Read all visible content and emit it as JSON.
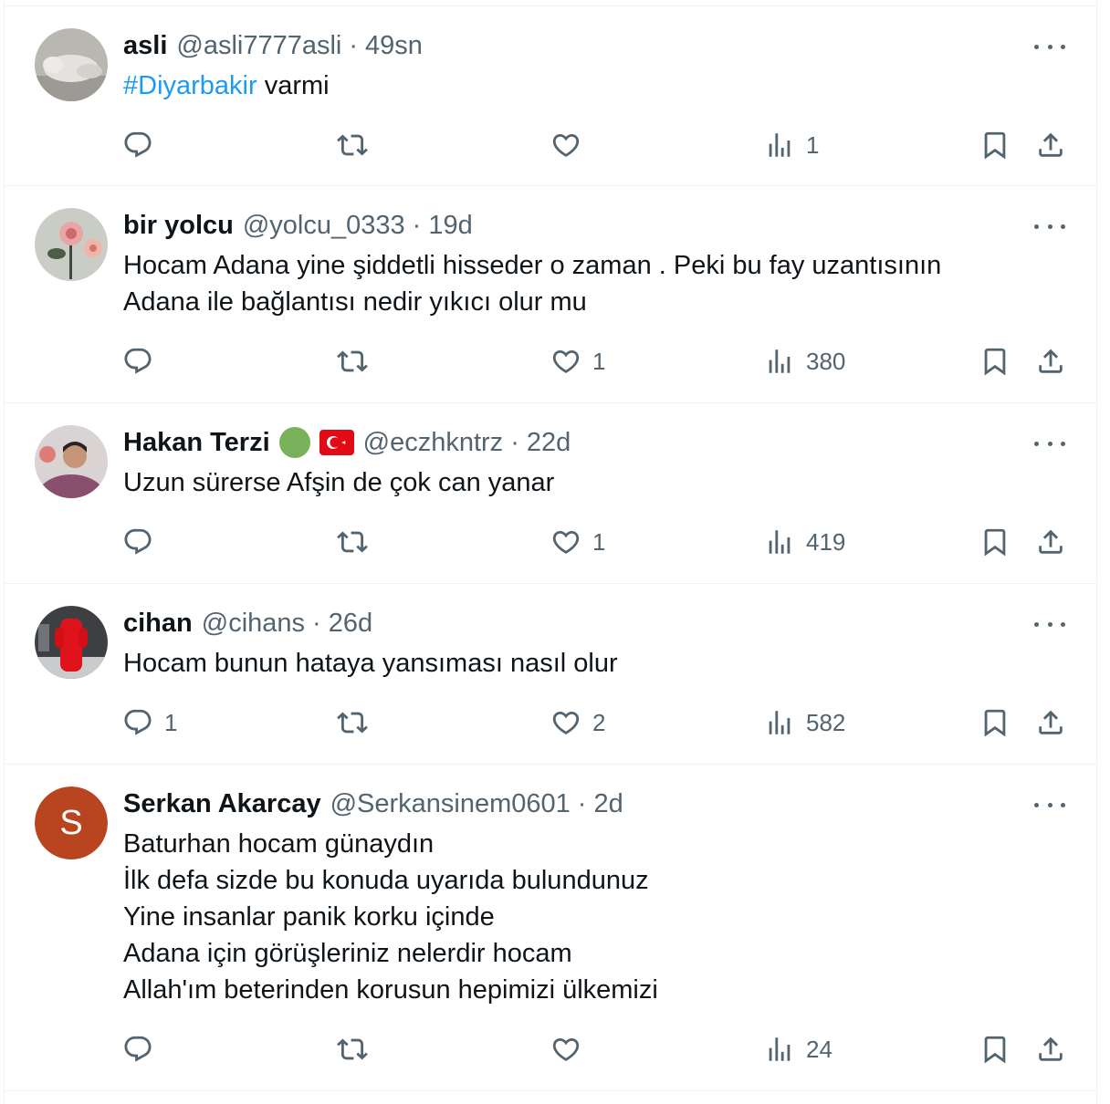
{
  "tweets": [
    {
      "name": "asli",
      "handle": "@asli7777asli",
      "time": "49sn",
      "hashtag": "#Diyarbakir",
      "text": " varmi",
      "replies": "",
      "retweets": "",
      "likes": "",
      "views": "1"
    },
    {
      "name": "bir yolcu",
      "handle": "@yolcu_0333",
      "time": "19d",
      "text": "Hocam Adana yine şiddetli hisseder o zaman . Peki bu fay uzantısının\nAdana ile bağlantısı nedir yıkıcı olur mu",
      "replies": "",
      "retweets": "",
      "likes": "1",
      "views": "380"
    },
    {
      "name": "Hakan Terzi",
      "handle": "@eczhkntrz",
      "time": "22d",
      "text": "Uzun sürerse Afşin de çok can yanar",
      "replies": "",
      "retweets": "",
      "likes": "1",
      "views": "419"
    },
    {
      "name": "cihan",
      "handle": "@cihans",
      "time": "26d",
      "text": "Hocam bunun hataya yansıması nasıl olur",
      "replies": "1",
      "retweets": "",
      "likes": "2",
      "views": "582"
    },
    {
      "name": "Serkan Akarcay",
      "handle": "@Serkansinem0601",
      "time": "2d",
      "avatar_letter": "S",
      "text": "Baturhan hocam günaydın\nİlk defa sizde bu konuda uyarıda bulundunuz\nYine insanlar panik korku içinde\nAdana için görüşleriniz nelerdir hocam\nAllah'ım beterinden korusun hepimizi ülkemizi",
      "replies": "",
      "retweets": "",
      "likes": "",
      "views": "24"
    }
  ],
  "separator": "·",
  "colors": {
    "text": "#0f1419",
    "secondary": "#536471",
    "link": "#1d9bf0",
    "border": "#eff3f4",
    "avatar_s": "#b8451f"
  },
  "icons": [
    "reply-icon",
    "retweet-icon",
    "like-icon",
    "views-icon",
    "bookmark-icon",
    "share-icon",
    "more-icon",
    "green-circle-emoji",
    "turkey-flag-emoji"
  ]
}
